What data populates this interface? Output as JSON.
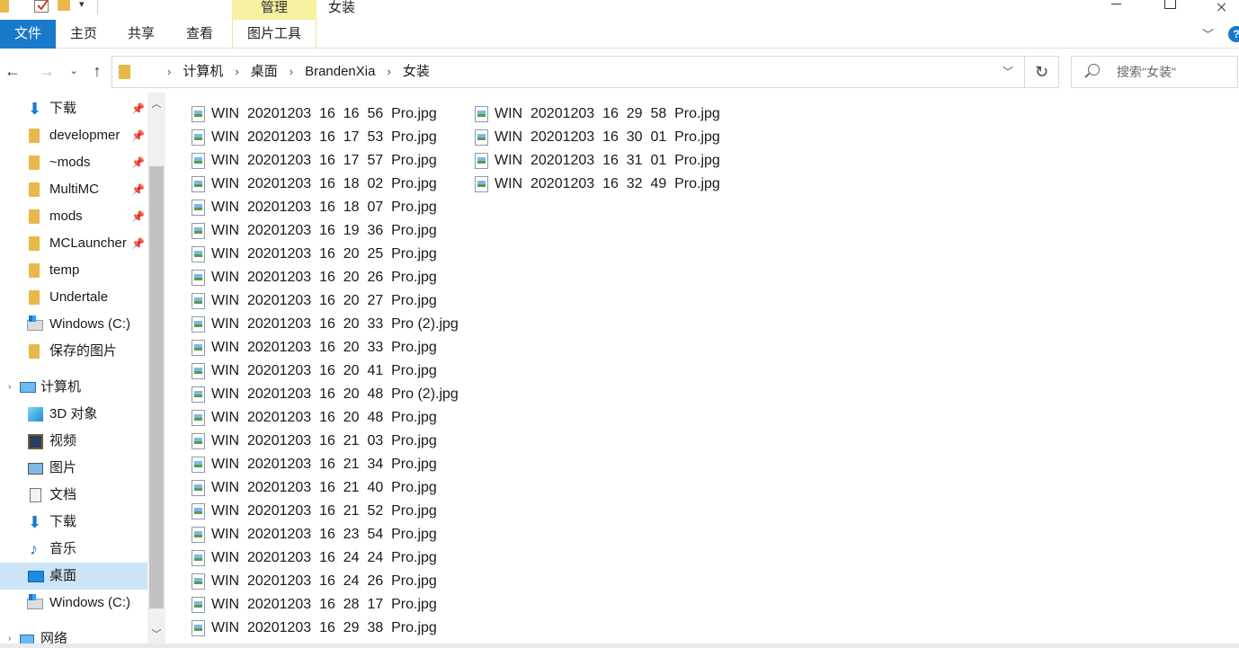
{
  "window": {
    "title": "女装",
    "manage_tab": "管理"
  },
  "ribbon": {
    "tabs": [
      "文件",
      "主页",
      "共享",
      "查看",
      "图片工具"
    ],
    "help": "?"
  },
  "address": {
    "breadcrumbs": [
      "计算机",
      "桌面",
      "BrandenXia",
      "女装"
    ],
    "separator": "›",
    "search_placeholder": "搜索\"女装\""
  },
  "sidebar": {
    "items": [
      {
        "label": "下载",
        "icon": "download-icon",
        "pinned": true
      },
      {
        "label": "developmer",
        "icon": "folder-icon",
        "pinned": true
      },
      {
        "label": "~mods",
        "icon": "folder-icon",
        "pinned": true
      },
      {
        "label": "MultiMC",
        "icon": "folder-icon",
        "pinned": true
      },
      {
        "label": "mods",
        "icon": "folder-icon",
        "pinned": true
      },
      {
        "label": "MCLauncher",
        "icon": "folder-icon",
        "pinned": true
      },
      {
        "label": "temp",
        "icon": "folder-icon",
        "pinned": false
      },
      {
        "label": "Undertale",
        "icon": "folder-icon",
        "pinned": false
      },
      {
        "label": "Windows (C:)",
        "icon": "drive-icon",
        "pinned": false
      },
      {
        "label": "保存的图片",
        "icon": "folder-icon",
        "pinned": false
      },
      {
        "label": "计算机",
        "icon": "computer-icon",
        "pinned": false
      },
      {
        "label": "3D 对象",
        "icon": "3d-objects-icon",
        "pinned": false
      },
      {
        "label": "视频",
        "icon": "video-icon",
        "pinned": false
      },
      {
        "label": "图片",
        "icon": "pictures-icon",
        "pinned": false
      },
      {
        "label": "文档",
        "icon": "documents-icon",
        "pinned": false
      },
      {
        "label": "下载",
        "icon": "download-icon",
        "pinned": false
      },
      {
        "label": "音乐",
        "icon": "music-icon",
        "pinned": false
      },
      {
        "label": "桌面",
        "icon": "desktop-icon",
        "pinned": false,
        "selected": true
      },
      {
        "label": "Windows (C:)",
        "icon": "drive-icon",
        "pinned": false
      },
      {
        "label": "网络",
        "icon": "network-icon",
        "pinned": false
      }
    ]
  },
  "files": {
    "column1": [
      "WIN  20201203  16  16  56  Pro.jpg",
      "WIN  20201203  16  17  53  Pro.jpg",
      "WIN  20201203  16  17  57  Pro.jpg",
      "WIN  20201203  16  18  02  Pro.jpg",
      "WIN  20201203  16  18  07  Pro.jpg",
      "WIN  20201203  16  19  36  Pro.jpg",
      "WIN  20201203  16  20  25  Pro.jpg",
      "WIN  20201203  16  20  26  Pro.jpg",
      "WIN  20201203  16  20  27  Pro.jpg",
      "WIN  20201203  16  20  33  Pro (2).jpg",
      "WIN  20201203  16  20  33  Pro.jpg",
      "WIN  20201203  16  20  41  Pro.jpg",
      "WIN  20201203  16  20  48  Pro (2).jpg",
      "WIN  20201203  16  20  48  Pro.jpg",
      "WIN  20201203  16  21  03  Pro.jpg",
      "WIN  20201203  16  21  34  Pro.jpg",
      "WIN  20201203  16  21  40  Pro.jpg",
      "WIN  20201203  16  21  52  Pro.jpg",
      "WIN  20201203  16  23  54  Pro.jpg",
      "WIN  20201203  16  24  24  Pro.jpg",
      "WIN  20201203  16  24  26  Pro.jpg",
      "WIN  20201203  16  28  17  Pro.jpg",
      "WIN  20201203  16  29  38  Pro.jpg"
    ],
    "column2": [
      "WIN  20201203  16  29  58  Pro.jpg",
      "WIN  20201203  16  30  01  Pro.jpg",
      "WIN  20201203  16  31  01  Pro.jpg",
      "WIN  20201203  16  32  49  Pro.jpg"
    ]
  },
  "colors": {
    "accent": "#1979ca",
    "selected_bg": "#cce4f7",
    "manage_bg": "#f6f0a0"
  }
}
